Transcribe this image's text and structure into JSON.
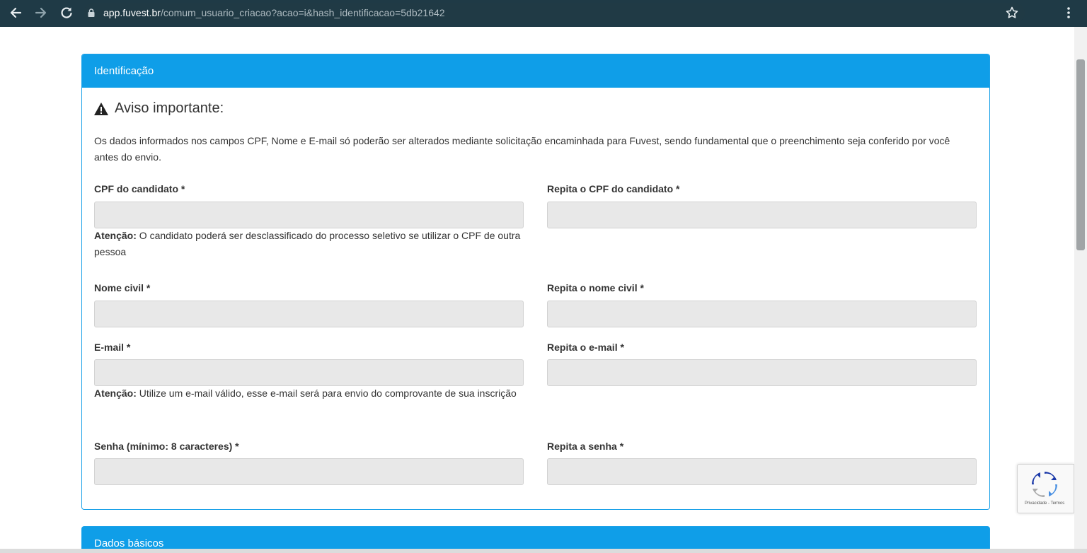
{
  "browser": {
    "url_host": "app.fuvest.br",
    "url_path": "/comum_usuario_criacao?acao=i&hash_identificacao=5db21642"
  },
  "identification": {
    "header": "Identificação",
    "warning_title": "Aviso importante:",
    "notice": "Os dados informados nos campos CPF, Nome e E-mail só poderão ser alterados mediante solicitação encaminhada para Fuvest, sendo fundamental que o preenchimento seja conferido por você antes do envio.",
    "fields": {
      "cpf": {
        "label": "CPF do candidato *",
        "value": "",
        "help_strong": "Atenção:",
        "help_text": " O candidato poderá ser desclassificado do processo seletivo se utilizar o CPF de outra pessoa"
      },
      "cpf_repeat": {
        "label": "Repita o CPF do candidato *",
        "value": ""
      },
      "name": {
        "label": "Nome civil *",
        "value": ""
      },
      "name_repeat": {
        "label": "Repita o nome civil *",
        "value": ""
      },
      "email": {
        "label": "E-mail *",
        "value": "",
        "help_strong": "Atenção:",
        "help_text": " Utilize um e-mail válido, esse e-mail será para envio do comprovante de sua inscrição"
      },
      "email_repeat": {
        "label": "Repita o e-mail *",
        "value": ""
      },
      "password": {
        "label": "Senha (mínimo: 8 caracteres) *",
        "value": ""
      },
      "password_repeat": {
        "label": "Repita a senha *",
        "value": ""
      }
    }
  },
  "basic_data": {
    "header": "Dados básicos"
  },
  "recaptcha": {
    "footer": "Privacidade - Termos"
  },
  "colors": {
    "header_blue": "#0f9ee8",
    "browser_bar": "#1f3a46",
    "input_bg": "#e8e8e8"
  },
  "icons": {
    "back": "arrow-left-icon",
    "forward": "arrow-right-icon",
    "reload": "reload-icon",
    "lock": "lock-icon",
    "star": "star-icon",
    "menu": "kebab-menu-icon",
    "warning": "warning-icon",
    "recaptcha": "recaptcha-icon"
  }
}
